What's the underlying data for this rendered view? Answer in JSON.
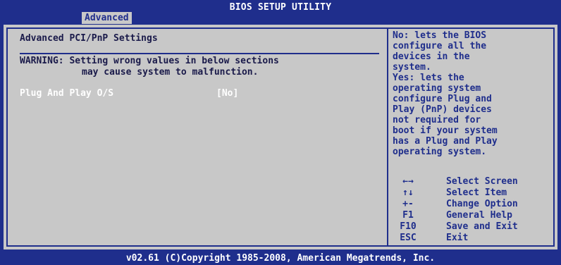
{
  "header": {
    "title": "BIOS SETUP UTILITY",
    "tab": "Advanced"
  },
  "main": {
    "section_title": "Advanced PCI/PnP Settings",
    "warning_line1": "WARNING: Setting wrong values in below sections",
    "warning_line2": "may cause system to malfunction.",
    "setting_label": "Plug And Play O/S",
    "setting_value": "[No]"
  },
  "help": {
    "text": "No: lets the BIOS\nconfigure all the\ndevices in the\nsystem.\nYes: lets the\noperating system\nconfigure Plug and\nPlay (PnP) devices\nnot required for\nboot if your system\nhas a Plug and Play\noperating system."
  },
  "keys": [
    {
      "key": "←→",
      "desc": "Select Screen"
    },
    {
      "key": "↑↓",
      "desc": "Select Item"
    },
    {
      "key": "+-",
      "desc": "Change Option"
    },
    {
      "key": "F1",
      "desc": "General Help"
    },
    {
      "key": "F10",
      "desc": "Save and Exit"
    },
    {
      "key": "ESC",
      "desc": "Exit"
    }
  ],
  "footer": {
    "copyright": "v02.61 (C)Copyright 1985-2008, American Megatrends, Inc."
  },
  "colors": {
    "background": "#1f2e8c",
    "panel": "#c8c8c8",
    "highlight_text": "#ffffff"
  }
}
